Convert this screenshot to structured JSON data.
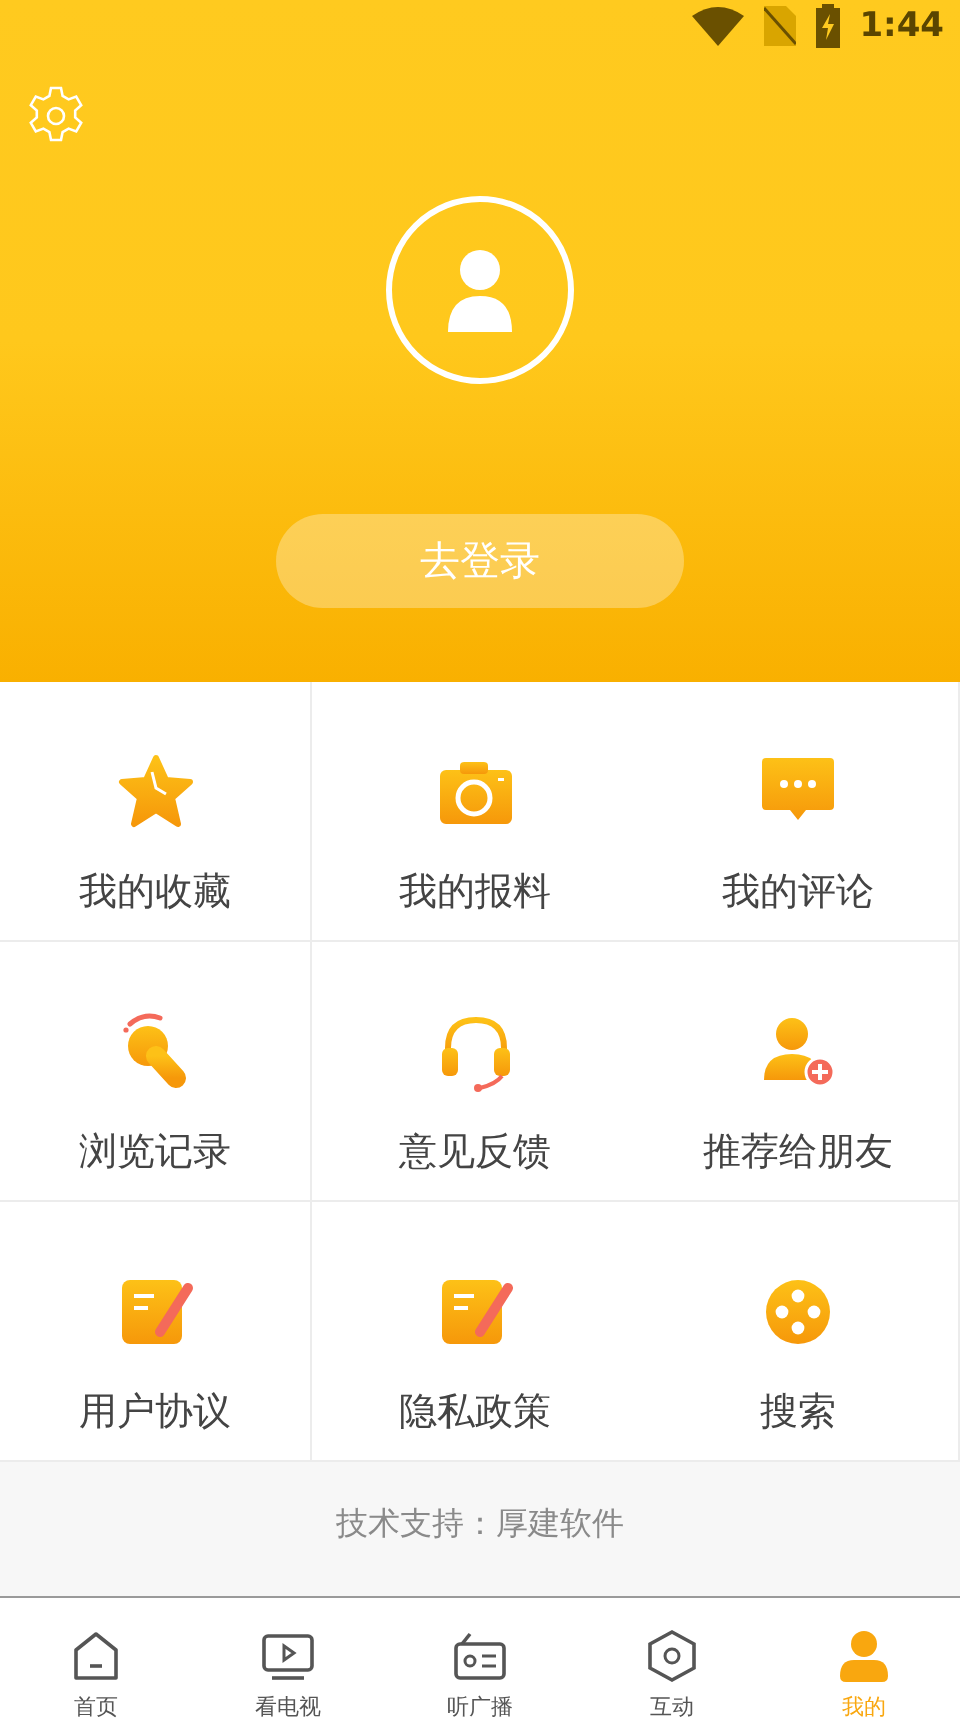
{
  "status_bar": {
    "time": "1:44"
  },
  "header": {
    "login_button": "去登录"
  },
  "menu": [
    {
      "label": "我的收藏"
    },
    {
      "label": "我的报料"
    },
    {
      "label": "我的评论"
    },
    {
      "label": "浏览记录"
    },
    {
      "label": "意见反馈"
    },
    {
      "label": "推荐给朋友"
    },
    {
      "label": "用户协议"
    },
    {
      "label": "隐私政策"
    },
    {
      "label": "搜索"
    }
  ],
  "footer": {
    "support": "技术支持：厚建软件"
  },
  "tabs": [
    {
      "label": "首页",
      "selected": false
    },
    {
      "label": "看电视",
      "selected": false
    },
    {
      "label": "听广播",
      "selected": false
    },
    {
      "label": "互动",
      "selected": false
    },
    {
      "label": "我的",
      "selected": true
    }
  ]
}
